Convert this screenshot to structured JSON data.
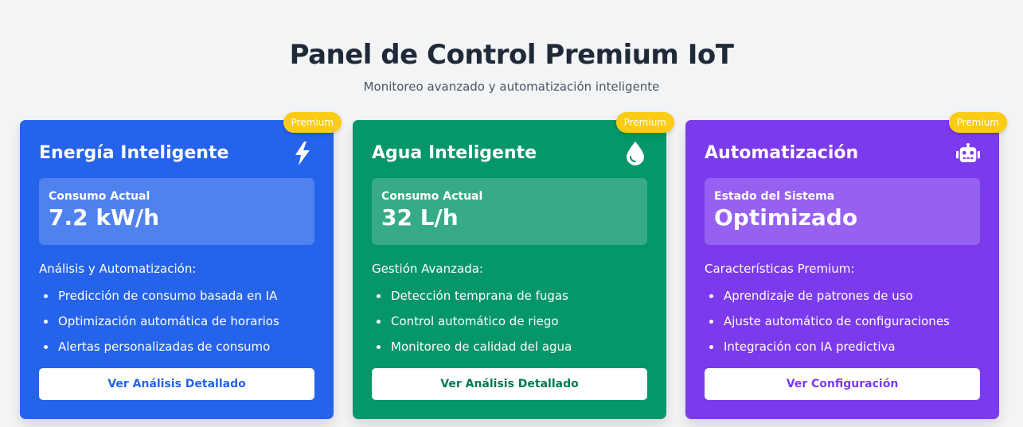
{
  "header": {
    "title": "Panel de Control Premium IoT",
    "subtitle": "Monitoreo avanzado y automatización inteligente"
  },
  "colors": {
    "page_bg": "#f3f4f6",
    "energy": "#2563eb",
    "water": "#059669",
    "automation": "#7c3aed",
    "badge": "#facc15"
  },
  "cards": [
    {
      "badge": "Premium",
      "title": "Energía Inteligente",
      "icon": "lightning-bolt-icon",
      "metric_label": "Consumo Actual",
      "metric_value": "7.2 kW/h",
      "section_label": "Análisis y Automatización:",
      "features": [
        "Predicción de consumo basada en IA",
        "Optimización automática de horarios",
        "Alertas personalizadas de consumo"
      ],
      "button": "Ver Análisis Detallado"
    },
    {
      "badge": "Premium",
      "title": "Agua Inteligente",
      "icon": "water-drop-icon",
      "metric_label": "Consumo Actual",
      "metric_value": "32 L/h",
      "section_label": "Gestión Avanzada:",
      "features": [
        "Detección temprana de fugas",
        "Control automático de riego",
        "Monitoreo de calidad del agua"
      ],
      "button": "Ver Análisis Detallado"
    },
    {
      "badge": "Premium",
      "title": "Automatización",
      "icon": "robot-icon",
      "metric_label": "Estado del Sistema",
      "metric_value": "Optimizado",
      "section_label": "Características Premium:",
      "features": [
        "Aprendizaje de patrones de uso",
        "Ajuste automático de configuraciones",
        "Integración con IA predictiva"
      ],
      "button": "Ver Configuración"
    }
  ]
}
